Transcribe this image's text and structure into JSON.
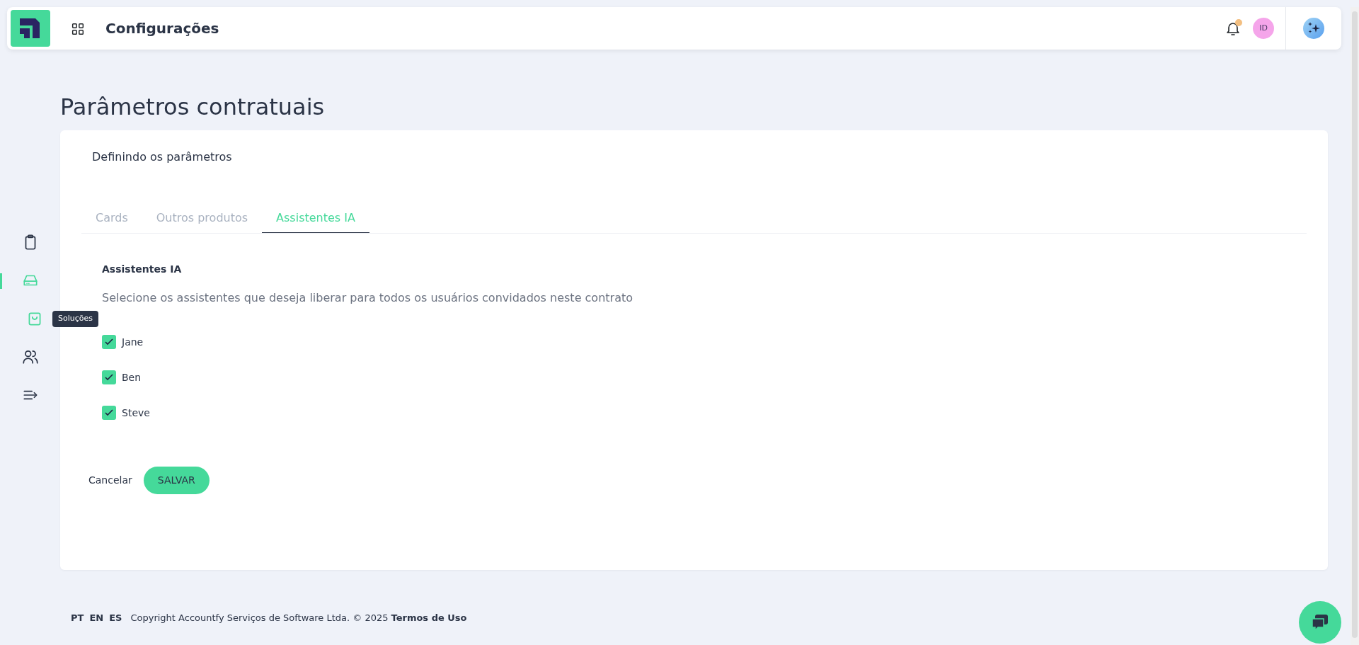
{
  "header": {
    "title": "Configurações",
    "avatar_initials": "ID",
    "notification_unread": true
  },
  "sidebar": {
    "items": [
      {
        "selected": false
      },
      {
        "selected": true
      },
      {
        "selected": false,
        "tooltip": "Soluções"
      },
      {
        "selected": false
      },
      {
        "selected": false
      }
    ]
  },
  "page_title": "Parâmetros contratuais",
  "card": {
    "subtitle": "Definindo os parâmetros",
    "tabs": [
      {
        "label": "Cards",
        "selected": false
      },
      {
        "label": "Outros produtos",
        "selected": false
      },
      {
        "label": "Assistentes IA",
        "selected": true
      }
    ],
    "section_title": "Assistentes IA",
    "section_description": "Selecione os assistentes que deseja liberar para todos os usuários convidados neste contrato",
    "assistants": [
      {
        "label": "Jane",
        "checked": true
      },
      {
        "label": "Ben",
        "checked": true
      },
      {
        "label": "Steve",
        "checked": true
      }
    ],
    "buttons": {
      "cancel": "Cancelar",
      "save": "SALVAR"
    }
  },
  "footer": {
    "languages": [
      "PT",
      "EN",
      "ES"
    ],
    "copyright": "Copyright Accountfy Serviços de Software Ltda. © 2025",
    "terms_link": "Termos de Uso"
  }
}
